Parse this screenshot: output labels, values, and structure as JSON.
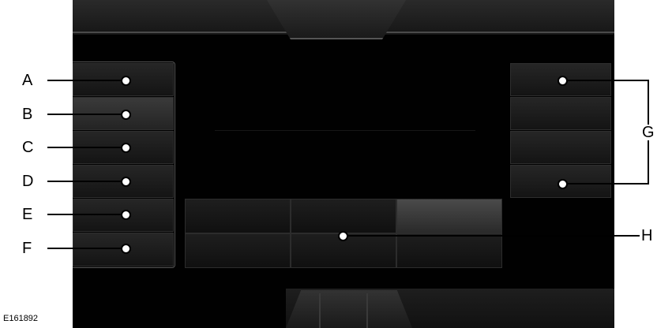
{
  "figure_code": "E161892",
  "callouts": {
    "A": "A",
    "B": "B",
    "C": "C",
    "D": "D",
    "E": "E",
    "F": "F",
    "G": "G",
    "H": "H"
  }
}
